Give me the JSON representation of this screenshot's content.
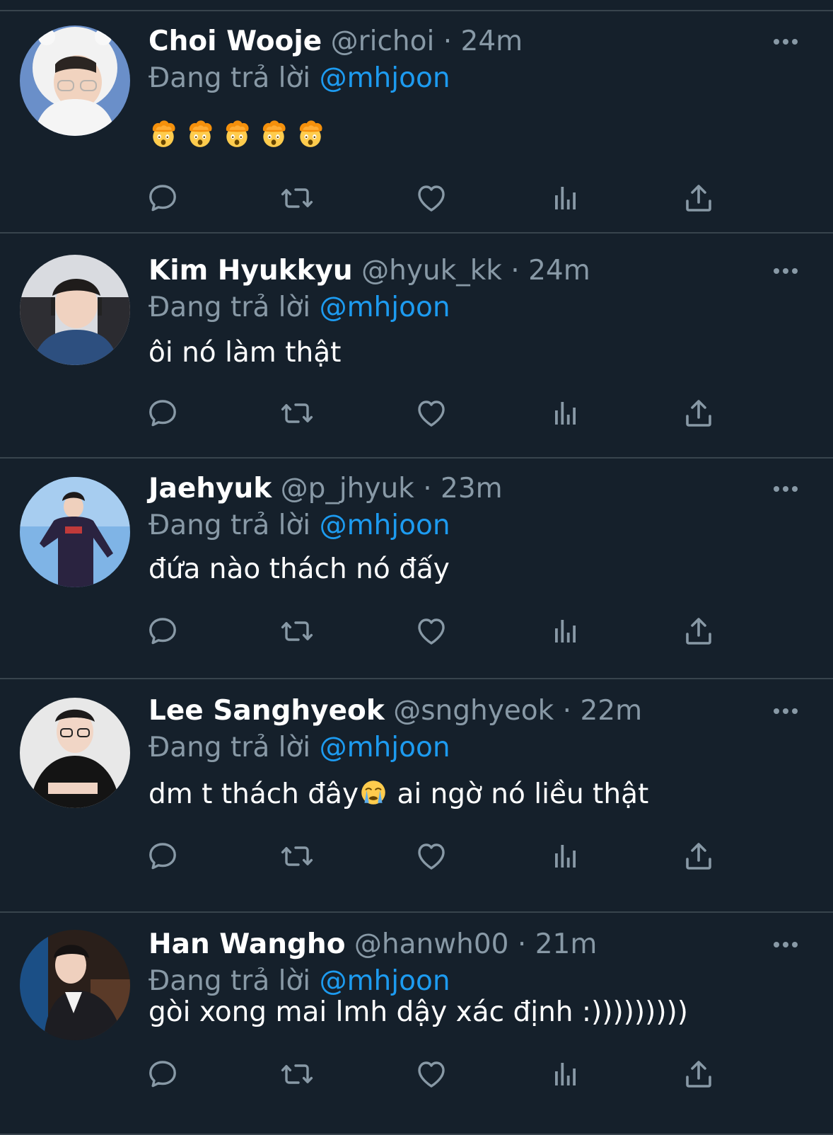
{
  "reply_prefix": "Đang trả lời",
  "colors": {
    "background": "#15202b",
    "divider": "#38444d",
    "secondary_text": "#8899a6",
    "mention": "#1d9bf0"
  },
  "icons": [
    "reply-icon",
    "retweet-icon",
    "like-icon",
    "analytics-icon",
    "share-icon",
    "more-icon"
  ],
  "tweets": [
    {
      "name": "Choi Wooje",
      "handle": "@richoi",
      "separator": "·",
      "time": "24m",
      "mention": "@mhjoon",
      "text": "",
      "emojis": [
        "exploding-head",
        "exploding-head",
        "exploding-head",
        "exploding-head",
        "exploding-head"
      ]
    },
    {
      "name": "Kim Hyukkyu",
      "handle": "@hyuk_kk",
      "separator": "·",
      "time": "24m",
      "mention": "@mhjoon",
      "text": "ôi nó làm thật"
    },
    {
      "name": "Jaehyuk",
      "handle": "@p_jhyuk",
      "separator": "·",
      "time": "23m",
      "mention": "@mhjoon",
      "text": "đứa nào thách nó đấy"
    },
    {
      "name": "Lee Sanghyeok",
      "handle": "@snghyeok",
      "separator": "·",
      "time": "22m",
      "mention": "@mhjoon",
      "text_before_emoji": "dm t thách đây",
      "text_after_emoji": " ai ngờ nó liều thật",
      "emoji": "loudly-crying-face"
    },
    {
      "name": "Han Wangho",
      "handle": "@hanwh00",
      "separator": "·",
      "time": "21m",
      "mention": "@mhjoon",
      "text": "gòi xong mai lmh dậy xác định :)))))))))"
    }
  ]
}
